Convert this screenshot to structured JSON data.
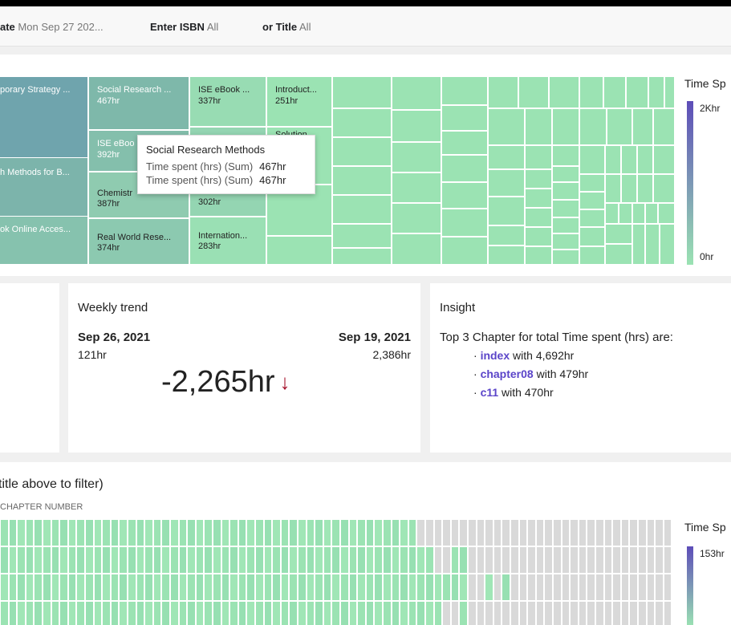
{
  "filters": {
    "date_label": "ate",
    "date_value": "Mon Sep 27 202...",
    "isbn_label": "Enter ISBN",
    "isbn_value": "All",
    "title_label": "or Title",
    "title_value": "All"
  },
  "treemap": {
    "tiles": [
      {
        "title": "porary Strategy ...",
        "value": ""
      },
      {
        "title": "h Methods for B...",
        "value": ""
      },
      {
        "title": "ok Online Acces...",
        "value": ""
      },
      {
        "title": "Social Research ...",
        "value": "467hr"
      },
      {
        "title": "ISE eBoo",
        "value": "392hr"
      },
      {
        "title": "Chemistr",
        "value": "387hr"
      },
      {
        "title": "Real World Rese...",
        "value": "374hr"
      },
      {
        "title": "ISE eBook ...",
        "value": "337hr"
      },
      {
        "title": "",
        "value": "302hr"
      },
      {
        "title": "Internation...",
        "value": "283hr"
      },
      {
        "title": "Introduct...",
        "value": "251hr"
      },
      {
        "title": "Solution...",
        "value": ""
      }
    ],
    "tooltip": {
      "title": "Social Research Methods",
      "rows": [
        {
          "label": "Time spent (hrs) (Sum)",
          "value": "467hr"
        },
        {
          "label": "Time spent (hrs) (Sum)",
          "value": "467hr"
        }
      ]
    },
    "legend": {
      "title": "Time Sp",
      "max": "2Khr",
      "min": "0hr"
    }
  },
  "weekly_trend": {
    "title": "Weekly trend",
    "current_date": "Sep 26, 2021",
    "current_value": "121hr",
    "previous_date": "Sep 19, 2021",
    "previous_value": "2,386hr",
    "change": "-2,265hr",
    "arrow": "↓"
  },
  "insight": {
    "title": "Insight",
    "summary": "Top 3 Chapter for total Time spent (hrs) are:",
    "items": [
      {
        "name": "index",
        "text": "with 4,692hr"
      },
      {
        "name": "chapter08",
        "text": "with 479hr"
      },
      {
        "name": "c11",
        "text": "with 470hr"
      }
    ]
  },
  "heatmap": {
    "title": "title above to filter)",
    "axis_label": "CHAPTER NUMBER",
    "legend": {
      "title": "Time Sp",
      "max": "153hr"
    }
  },
  "colors": {
    "tile_green": "#9be3b3",
    "tile_teal_dark": "#6e9fae",
    "legend_purple": "#5d4db8",
    "down_arrow": "#a5102a",
    "insight_link": "#5b45c9",
    "heatmap_empty": "#d9d9d9"
  }
}
